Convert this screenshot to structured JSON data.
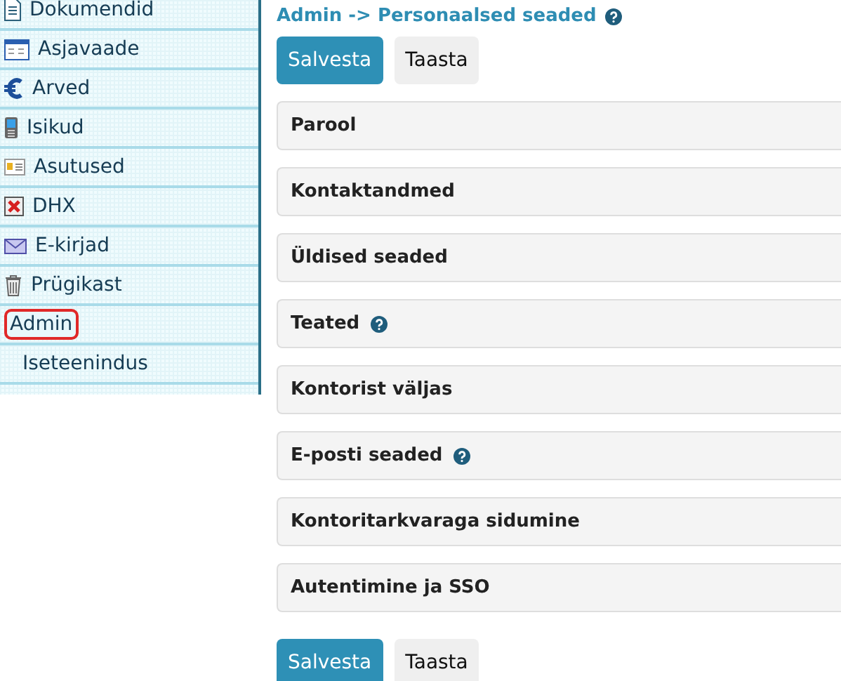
{
  "sidebar": {
    "items": [
      {
        "label": "Dokumendid",
        "selected": false
      },
      {
        "label": "Asjavaade",
        "selected": false
      },
      {
        "label": "Arved",
        "selected": false
      },
      {
        "label": "Isikud",
        "selected": false
      },
      {
        "label": "Asutused",
        "selected": false
      },
      {
        "label": "DHX",
        "selected": false
      },
      {
        "label": "E-kirjad",
        "selected": false
      },
      {
        "label": "Prügikast",
        "selected": false
      },
      {
        "label": "Admin",
        "selected": true,
        "children": [
          {
            "label": "Iseteenindus",
            "selected": false
          }
        ]
      }
    ]
  },
  "breadcrumb": {
    "text": "Admin -> Personaalsed seaded",
    "help": true
  },
  "top_buttons": [
    {
      "label": "Salvesta",
      "kind": "primary"
    },
    {
      "label": "Taasta",
      "kind": "secondary"
    }
  ],
  "panels": [
    {
      "title": "Parool",
      "help": false
    },
    {
      "title": "Kontaktandmed",
      "help": false
    },
    {
      "title": "Üldised seaded",
      "help": false
    },
    {
      "title": "Teated",
      "help": true
    },
    {
      "title": "Kontorist väljas",
      "help": false
    },
    {
      "title": "E-posti seaded",
      "help": true
    },
    {
      "title": "Kontoritarkvaraga sidumine",
      "help": false
    },
    {
      "title": "Autentimine ja SSO",
      "help": false
    }
  ],
  "bottom_buttons": [
    {
      "label": "Salvesta",
      "kind": "primary"
    },
    {
      "label": "Taasta",
      "kind": "secondary"
    }
  ]
}
